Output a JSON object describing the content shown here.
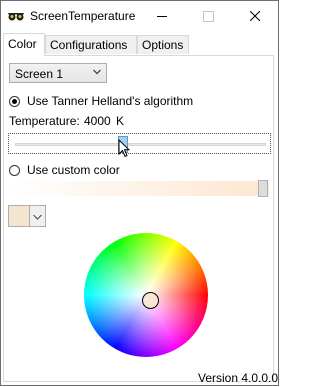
{
  "window": {
    "title": "ScreenTemperature",
    "icon": "sunglasses-icon"
  },
  "tabs": [
    {
      "label": "Color",
      "active": true
    },
    {
      "label": "Configurations",
      "active": false
    },
    {
      "label": "Options",
      "active": false
    }
  ],
  "screen_select": {
    "value": "Screen 1"
  },
  "algorithm": {
    "label": "Use Tanner Helland's algorithm",
    "checked": true
  },
  "temperature": {
    "label": "Temperature:",
    "value": "4000",
    "unit": "K",
    "slider_fraction": 0.45
  },
  "custom_color": {
    "label": "Use custom color",
    "checked": false,
    "slider_fraction": 1.0,
    "swatch_color": "#f5e4d0"
  },
  "version": "Version 4.0.0.0"
}
